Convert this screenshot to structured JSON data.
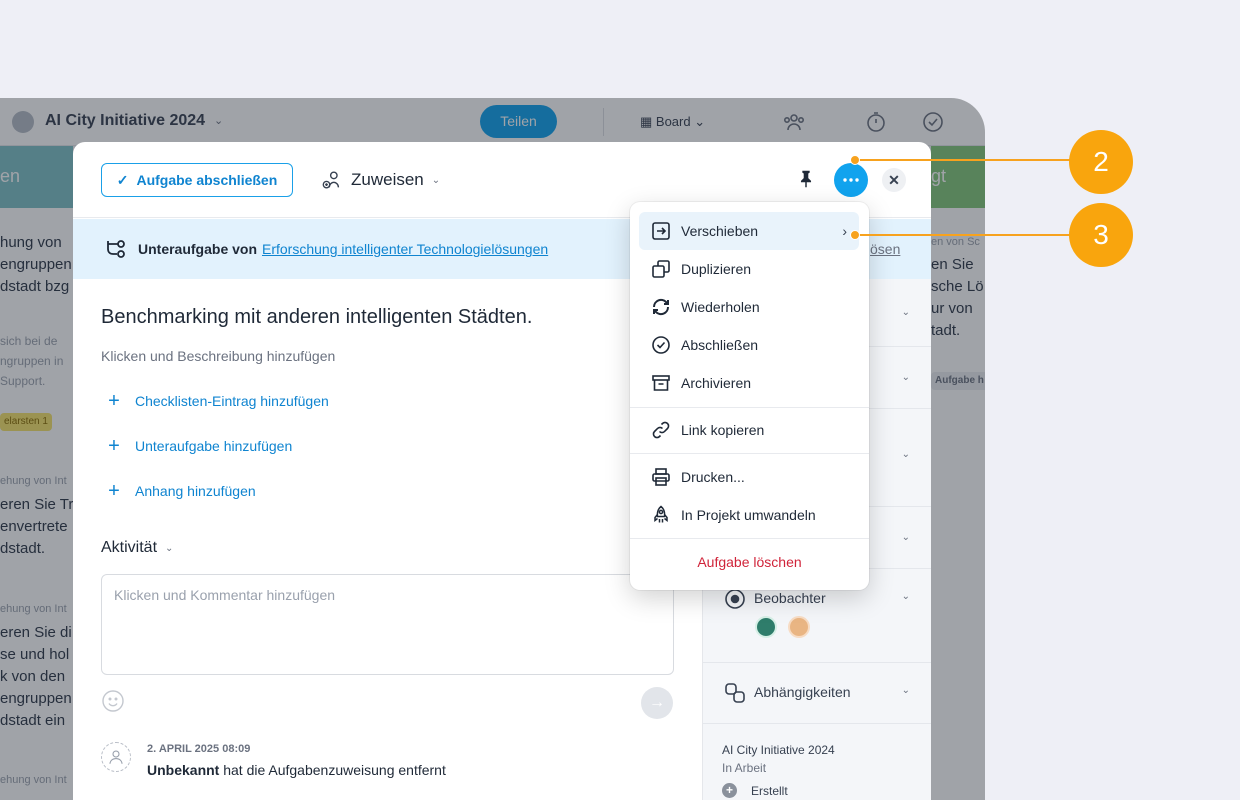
{
  "app": {
    "project_title": "AI City Initiative 2024",
    "share_label": "Teilen",
    "view_label": "Board",
    "left_column": {
      "header": "en",
      "lines": [
        "hung von",
        "engruppen",
        "dstadt bzg",
        "sich bei de",
        "ngruppen in",
        "Support.",
        "elarsten 1",
        "ehung von Int",
        "eren Sie Tr",
        "envertrete",
        "dstadt.",
        "ehung von Int",
        "eren Sie di",
        "se und hol",
        "k von den",
        "engruppen",
        "dstadt ein",
        "ehung von Int"
      ]
    },
    "right_column": {
      "header": "gt",
      "lines": [
        "en von Sc",
        "en Sie",
        "sche Lö",
        "ur von",
        "tadt.",
        "Aufgabe h"
      ]
    }
  },
  "modal": {
    "complete_label": "Aufgabe abschließen",
    "assign_label": "Zuweisen",
    "subtask_prefix": "Unteraufgabe von",
    "subtask_parent": "Erforschung intelligenter Technologielösungen",
    "subtask_partial": "ösen",
    "title": "Benchmarking mit anderen intelligenten Städten.",
    "description_placeholder": "Klicken und Beschreibung hinzufügen",
    "add_checklist": "Checklisten-Eintrag hinzufügen",
    "add_subtask": "Unteraufgabe hinzufügen",
    "add_attachment": "Anhang hinzufügen",
    "activity_label": "Aktivität",
    "comment_placeholder": "Klicken und Kommentar hinzufügen",
    "activity_entry": {
      "date": "2. APRIL 2025 08:09",
      "actor": "Unbekannt",
      "text": "hat die Aufgabenzuweisung entfernt"
    },
    "side": {
      "watchers_label": "Beobachter",
      "dependencies_label": "Abhängigkeiten",
      "project": "AI City Initiative 2024",
      "status": "In Arbeit",
      "created_label": "Erstellt"
    }
  },
  "menu": {
    "items": [
      {
        "label": "Verschieben",
        "icon": "move-icon"
      },
      {
        "label": "Duplizieren",
        "icon": "duplicate-icon"
      },
      {
        "label": "Wiederholen",
        "icon": "repeat-icon"
      },
      {
        "label": "Abschließen",
        "icon": "check-circle-icon"
      },
      {
        "label": "Archivieren",
        "icon": "archive-icon"
      },
      {
        "label": "Link kopieren",
        "icon": "link-icon"
      },
      {
        "label": "Drucken...",
        "icon": "print-icon"
      },
      {
        "label": "In Projekt umwandeln",
        "icon": "rocket-icon"
      }
    ],
    "delete_label": "Aufgabe löschen"
  },
  "callouts": [
    {
      "label": "2"
    },
    {
      "label": "3"
    }
  ],
  "colors": {
    "accent": "#11a3ee",
    "callout": "#f9a50d",
    "danger": "#d0243a",
    "subtask_bg": "#e2f2fd"
  }
}
